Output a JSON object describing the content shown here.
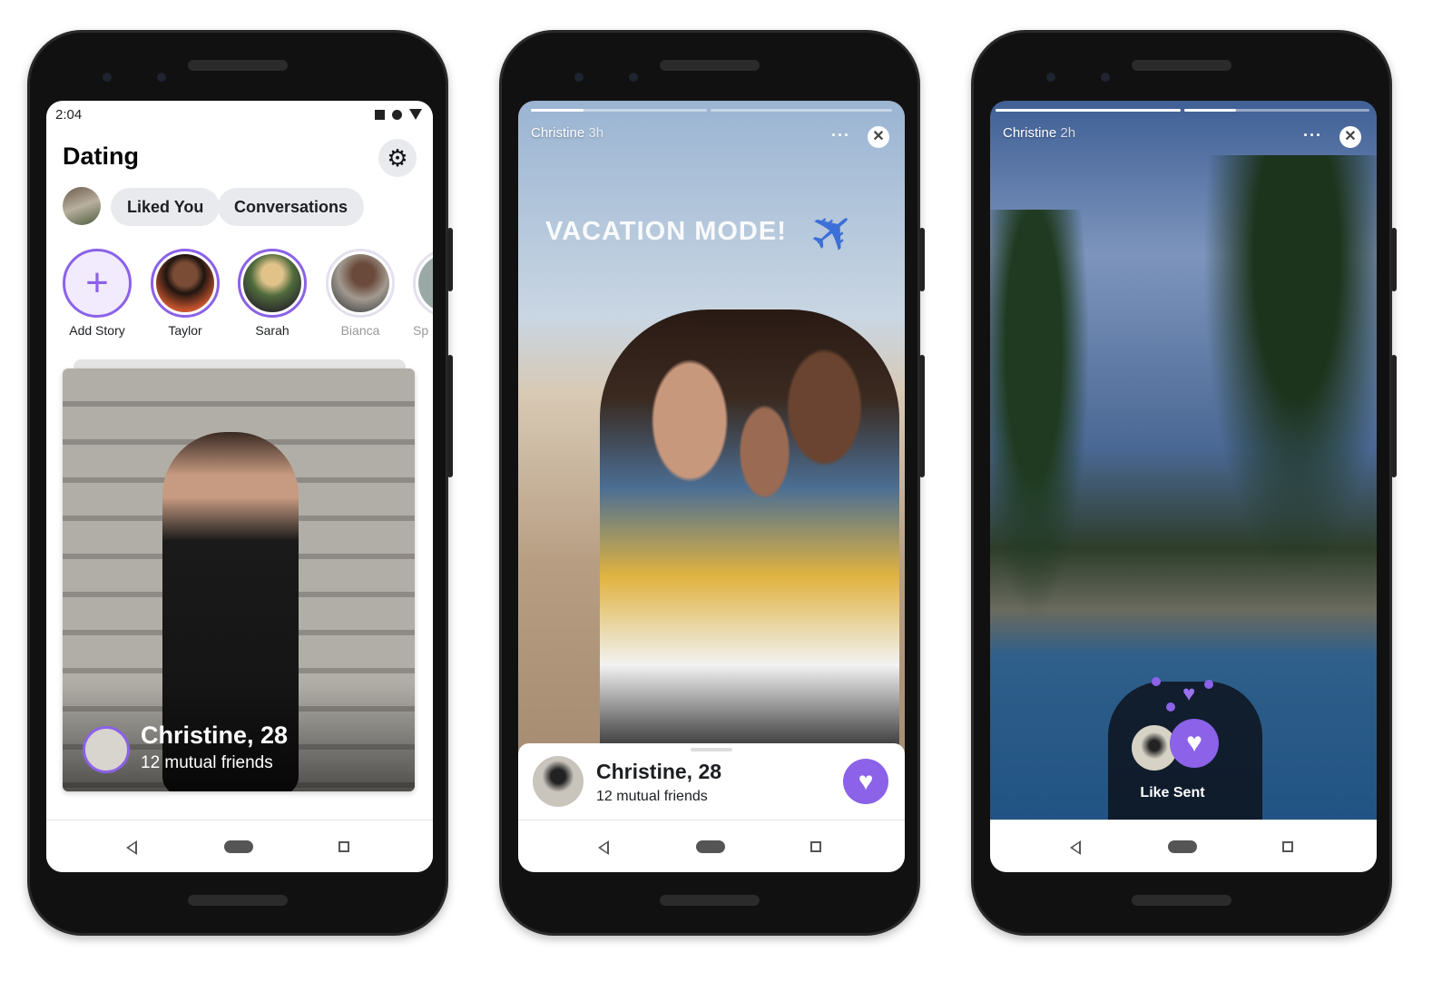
{
  "phone1": {
    "status": {
      "time": "2:04"
    },
    "title": "Dating",
    "settings_icon": "gear-icon",
    "tabs": [
      {
        "label": "Liked You"
      },
      {
        "label": "Conversations"
      }
    ],
    "stories": [
      {
        "label": "Add Story",
        "icon": "plus-icon"
      },
      {
        "label": "Taylor"
      },
      {
        "label": "Sarah"
      },
      {
        "label": "Bianca"
      },
      {
        "label": "Sp"
      }
    ],
    "card": {
      "name": "Christine, 28",
      "subtitle": "12 mutual friends"
    }
  },
  "phone2": {
    "story_user": "Christine",
    "story_age": "3h",
    "overlay_text": "VACATION MODE!",
    "profile": {
      "name": "Christine, 28",
      "subtitle": "12 mutual friends"
    },
    "like_icon": "heart-icon"
  },
  "phone3": {
    "story_user": "Christine",
    "story_age": "2h",
    "like_status": "Like Sent"
  },
  "colors": {
    "accent": "#8b62e8"
  }
}
